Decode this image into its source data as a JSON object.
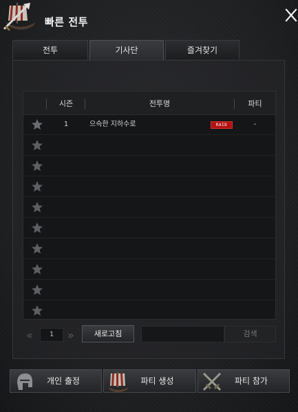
{
  "window": {
    "title": "빠른 전투"
  },
  "tabs": [
    {
      "label": "전투",
      "active": false
    },
    {
      "label": "기사단",
      "active": true
    },
    {
      "label": "즐겨찾기",
      "active": false
    }
  ],
  "table": {
    "headers": {
      "season": "시즌",
      "name": "전투명",
      "party": "파티"
    },
    "rows": [
      {
        "season": "1",
        "name": "으슥한 지하수로",
        "badge": "RAID",
        "party": "-"
      },
      {
        "season": "",
        "name": "",
        "badge": "",
        "party": ""
      },
      {
        "season": "",
        "name": "",
        "badge": "",
        "party": ""
      },
      {
        "season": "",
        "name": "",
        "badge": "",
        "party": ""
      },
      {
        "season": "",
        "name": "",
        "badge": "",
        "party": ""
      },
      {
        "season": "",
        "name": "",
        "badge": "",
        "party": ""
      },
      {
        "season": "",
        "name": "",
        "badge": "",
        "party": ""
      },
      {
        "season": "",
        "name": "",
        "badge": "",
        "party": ""
      },
      {
        "season": "",
        "name": "",
        "badge": "",
        "party": ""
      },
      {
        "season": "",
        "name": "",
        "badge": "",
        "party": ""
      }
    ]
  },
  "pager": {
    "prev": "«",
    "page": "1",
    "next": "»"
  },
  "controls": {
    "refresh_label": "새로고침",
    "search_value": "",
    "search_label": "검색"
  },
  "buttons": {
    "solo": "개인 출정",
    "create_party": "파티 생성",
    "join_party": "파티 참가"
  },
  "colors": {
    "raid_badge": "#b31212",
    "background": "#1b1c1e",
    "star": "#6b6c70"
  }
}
